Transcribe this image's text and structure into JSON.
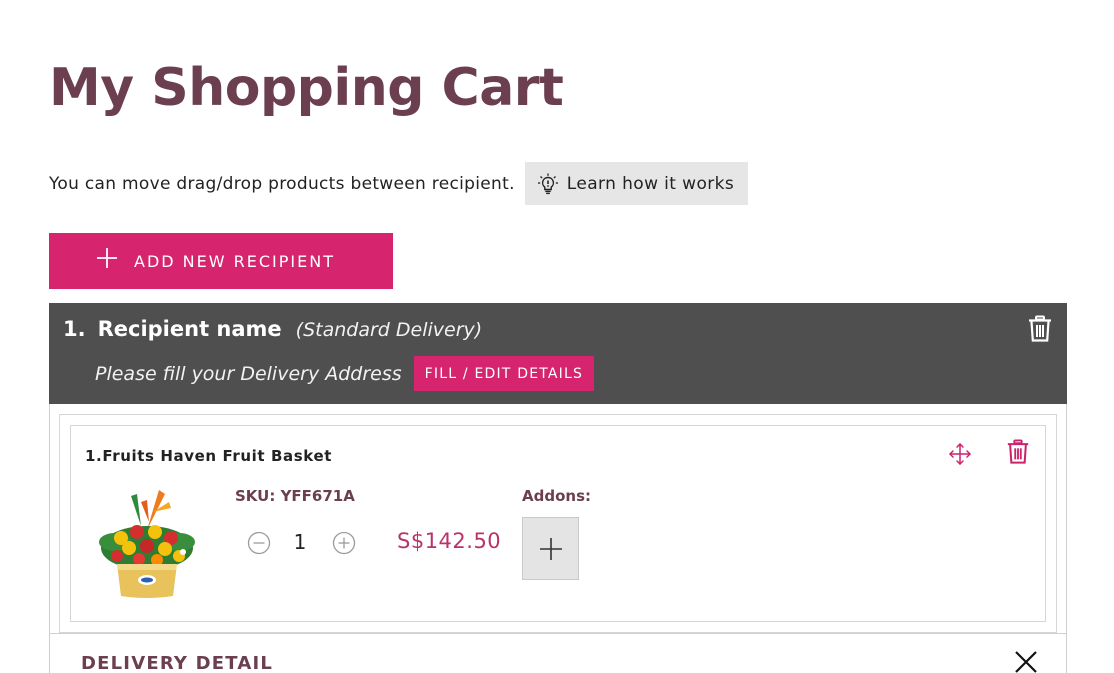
{
  "page": {
    "title": "My Shopping Cart"
  },
  "hint": {
    "text": "You can move drag/drop products between recipient.",
    "learn_label": "Learn how it works",
    "learn_icon": "lightbulb-icon"
  },
  "actions": {
    "add_recipient_label": "ADD NEW RECIPIENT"
  },
  "recipients": [
    {
      "number": "1.",
      "name_label": "Recipient name",
      "delivery_type": "(Standard Delivery)",
      "address_prompt": "Please fill your Delivery Address",
      "fill_button": "FILL / EDIT DETAILS",
      "products": [
        {
          "title": "1.Fruits Haven Fruit Basket",
          "sku": "SKU: YFF671A",
          "quantity": "1",
          "price": "S$142.50",
          "addons_label": "Addons:"
        }
      ],
      "delivery_detail_label": "DELIVERY DETAIL"
    }
  ],
  "colors": {
    "title": "#6b3f50",
    "accent": "#d7246f",
    "header_bg": "#4f4f4f",
    "price": "#b8336a",
    "icon_accent": "#c9246b"
  }
}
